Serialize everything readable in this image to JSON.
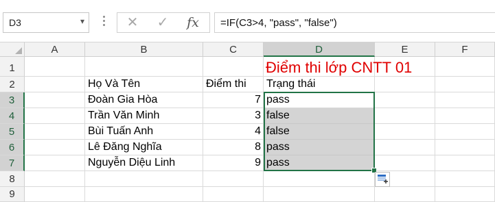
{
  "formula_bar": {
    "name_box": "D3",
    "cancel_icon": "close-icon",
    "enter_icon": "check-icon",
    "fx_label": "fx",
    "formula": "=IF(C3>4, \"pass\", \"false\")"
  },
  "columns": [
    "A",
    "B",
    "C",
    "D",
    "E",
    "F"
  ],
  "rows": [
    "1",
    "2",
    "3",
    "4",
    "5",
    "6",
    "7",
    "8",
    "9"
  ],
  "sheet": {
    "title": "Điểm thi lớp CNTT 01",
    "headers": {
      "name": "Họ Và Tên",
      "score": "Điểm thi",
      "status": "Trạng thái"
    },
    "records": [
      {
        "name": "Đoàn Gia Hòa",
        "score": "7",
        "status": "pass"
      },
      {
        "name": "Trần Văn Minh",
        "score": "3",
        "status": "false"
      },
      {
        "name": "Bùi Tuấn Anh",
        "score": "4",
        "status": "false"
      },
      {
        "name": "Lê Đăng Nghĩa",
        "score": "8",
        "status": "pass"
      },
      {
        "name": "Nguyễn Diệu Linh",
        "score": "9",
        "status": "pass"
      }
    ]
  },
  "colors": {
    "accent": "#217346",
    "title": "#e00000",
    "selection": "#d4d4d4"
  }
}
